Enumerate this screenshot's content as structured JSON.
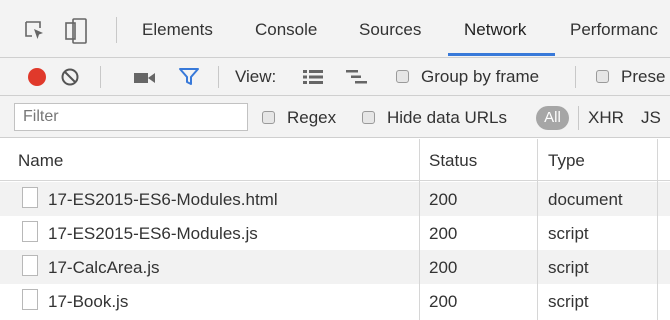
{
  "tabs": {
    "items": [
      "Elements",
      "Console",
      "Sources",
      "Network",
      "Performanc"
    ],
    "active": "Network"
  },
  "toolbar": {
    "view_label": "View:",
    "group_by_frame_label": "Group by frame",
    "preserve_label": "Prese"
  },
  "filter": {
    "placeholder": "Filter",
    "regex_label": "Regex",
    "hide_data_urls_label": "Hide data URLs",
    "type_all": "All",
    "type_xhr": "XHR",
    "type_js": "JS"
  },
  "table": {
    "headers": {
      "name": "Name",
      "status": "Status",
      "type": "Type"
    },
    "rows": [
      {
        "name": "17-ES2015-ES6-Modules.html",
        "status": "200",
        "type": "document"
      },
      {
        "name": "17-ES2015-ES6-Modules.js",
        "status": "200",
        "type": "script"
      },
      {
        "name": "17-CalcArea.js",
        "status": "200",
        "type": "script"
      },
      {
        "name": "17-Book.js",
        "status": "200",
        "type": "script"
      }
    ]
  },
  "colors": {
    "record_red": "#e0392b",
    "filter_blue": "#3879d9",
    "active_tab_underline": "#3879d9"
  },
  "icons": [
    "inspect-element-icon",
    "device-toolbar-icon",
    "record-icon",
    "clear-icon",
    "camera-icon",
    "filter-icon",
    "large-rows-icon",
    "waterfall-icon",
    "file-icon"
  ]
}
